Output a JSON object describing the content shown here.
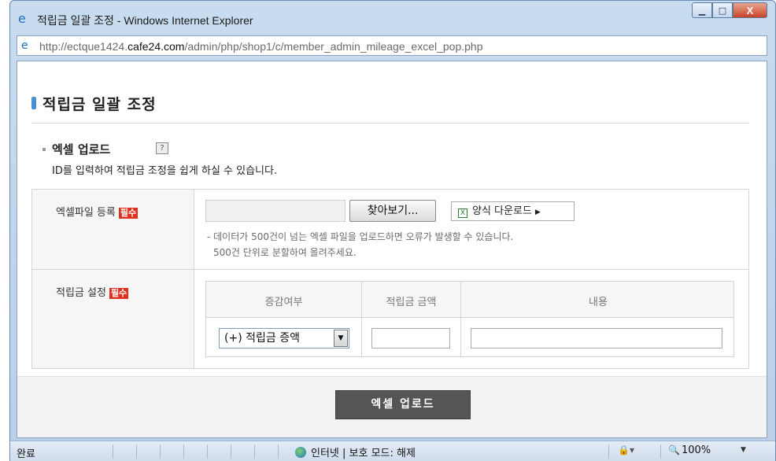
{
  "window": {
    "title": "적립금 일괄 조정 - Windows Internet Explorer",
    "url_prefix": "http://ectque1424.",
    "url_domain": "cafe24.com",
    "url_path": "/admin/php/shop1/c/member_admin_mileage_excel_pop.php",
    "minimize_glyph": "▁",
    "maximize_glyph": "□",
    "close_glyph": "X"
  },
  "page": {
    "title": "적립금 일괄 조정",
    "section_title": "엑셀 업로드",
    "help_glyph": "?",
    "section_desc": "ID를 입력하여 적립금 조정을 쉽게 하실 수 있습니다."
  },
  "form": {
    "file_label": "엑셀파일 등록",
    "required_badge": "필수",
    "browse_label": "찾아보기...",
    "excel_glyph": "X",
    "download_label": "양식 다운로드",
    "download_arrow": "▶",
    "note_line1": "- 데이터가 500건이 넘는 엑셀 파일을 업로드하면 오류가 발생할 수 있습니다.",
    "note_line2": "500건 단위로 분할하여 올려주세요.",
    "mileage_label": "적립금 설정",
    "columns": [
      "증감여부",
      "적립금 금액",
      "내용"
    ],
    "select_value": "(+) 적립금 증액",
    "select_arrow": "▼",
    "amount_value": "",
    "memo_value": ""
  },
  "footer": {
    "upload_button": "엑셀 업로드"
  },
  "statusbar": {
    "done": "완료",
    "zone": "인터넷 | 보호 모드: 해제",
    "security_glyph": "🔒▾",
    "zoom_glyph": "🔍",
    "zoom": "100%",
    "zoom_arrow": "▼"
  }
}
